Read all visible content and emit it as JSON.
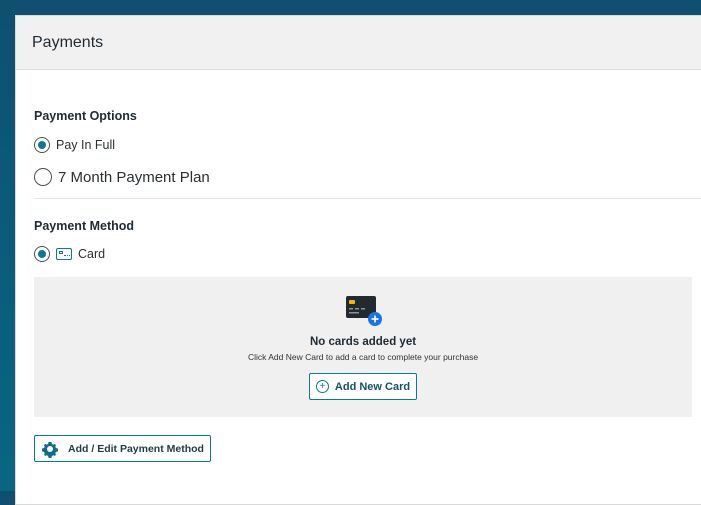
{
  "header": {
    "title": "Payments"
  },
  "payment_options": {
    "title": "Payment Options",
    "options": [
      {
        "label": "Pay In Full",
        "selected": true
      },
      {
        "label": "7 Month Payment Plan",
        "selected": false
      }
    ]
  },
  "payment_method": {
    "title": "Payment Method",
    "options": [
      {
        "label": "Card",
        "selected": true,
        "icon": "card-icon"
      }
    ]
  },
  "empty_state": {
    "icon": "credit-card-add-icon",
    "title": "No cards added yet",
    "subtitle": "Click Add New Card to add a card to complete your purchase",
    "add_button": "Add New Card"
  },
  "edit_button": {
    "label": "Add / Edit Payment Method",
    "icon": "gear-icon"
  },
  "colors": {
    "accent": "#0a7a8c",
    "plus_badge": "#1a73e8",
    "background": "#0b5a78"
  }
}
